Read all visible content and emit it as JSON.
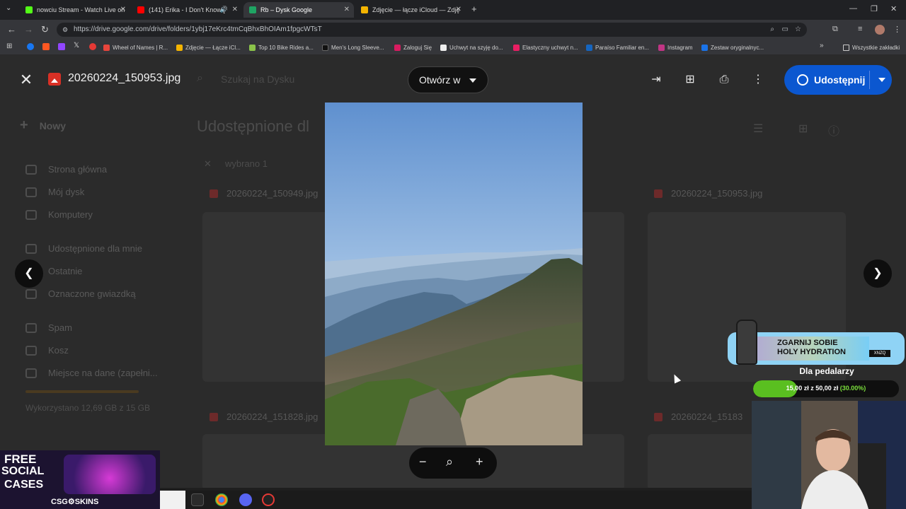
{
  "browser": {
    "tabs": [
      {
        "title": "nowciu Stream - Watch Live on",
        "favicon_color": "#53fc18"
      },
      {
        "title": "(141) Erika - I Don't Know [",
        "favicon_color": "#ff0000"
      },
      {
        "title": "Rb – Dysk Google",
        "favicon_color": "#1fa463"
      },
      {
        "title": "Zdjęcie — łącze iCloud — Zdję",
        "favicon_color": "#f4b400"
      }
    ],
    "url": "https://drive.google.com/drive/folders/1ybj17eKrc4tmCqBhxBhOIAm1fpgcWTsT",
    "bookmarks": [
      {
        "label": "Wheel of Names | R...",
        "color": "#e8453c"
      },
      {
        "label": "Zdjęcie — Łącze iCl...",
        "color": "#f4b400"
      },
      {
        "label": "Top 10 Bike Rides a...",
        "color": "#8bc34a"
      },
      {
        "label": "Men's Long Sleeve...",
        "color": "#111111"
      },
      {
        "label": "Zaloguj Się",
        "color": "#d81b60"
      },
      {
        "label": "Uchwyt na szyję do...",
        "color": "#eeeeee"
      },
      {
        "label": "Elastyczny uchwyt n...",
        "color": "#e91e63"
      },
      {
        "label": "Paraíso Familiar en...",
        "color": "#1565c0"
      },
      {
        "label": "Instagram",
        "color": "#c13584"
      },
      {
        "label": "Zestaw oryginalnyc...",
        "color": "#1a73e8"
      }
    ],
    "all_bookmarks": "Wszystkie zakładki"
  },
  "drive": {
    "search_placeholder": "Szukaj na Dysku",
    "new_button": "Nowy",
    "sidebar": [
      "Strona główna",
      "Mój dysk",
      "Komputery",
      "Udostępnione dla mnie",
      "Ostatnie",
      "Oznaczone gwiazdką",
      "Spam",
      "Kosz",
      "Miejsce na dane (zapełni..."
    ],
    "storage_text": "Wykorzystano 12,69 GB z 15 GB",
    "page_title": "Udostępnione dl",
    "selection_text": "wybrano 1",
    "files": [
      "20260224_150949.jpg",
      "20260224_150953.jpg",
      "20260224_151828.jpg",
      "20260224_15183"
    ]
  },
  "viewer": {
    "file_name": "20260224_150953.jpg",
    "open_with": "Otwórz w",
    "share": "Udostępnij",
    "icons": [
      "move-icon",
      "add-comment-icon",
      "print-icon",
      "more-icon"
    ]
  },
  "overlays": {
    "promo_line1": "ZGARNIJ SOBIE",
    "promo_line2": "HOLY HYDRATION",
    "promo_code": "XNZQ",
    "goal_title": "Dla pedalarzy",
    "goal_current": "15,00 zł",
    "goal_sep": "z",
    "goal_target": "50,00 zł",
    "goal_percent_text": "(30.00%)",
    "goal_fraction": 0.3,
    "ad_line1": "FREE",
    "ad_line2": "SOCIAL",
    "ad_line3": "CASES",
    "ad_brand": "CSG⚙SKINS"
  }
}
